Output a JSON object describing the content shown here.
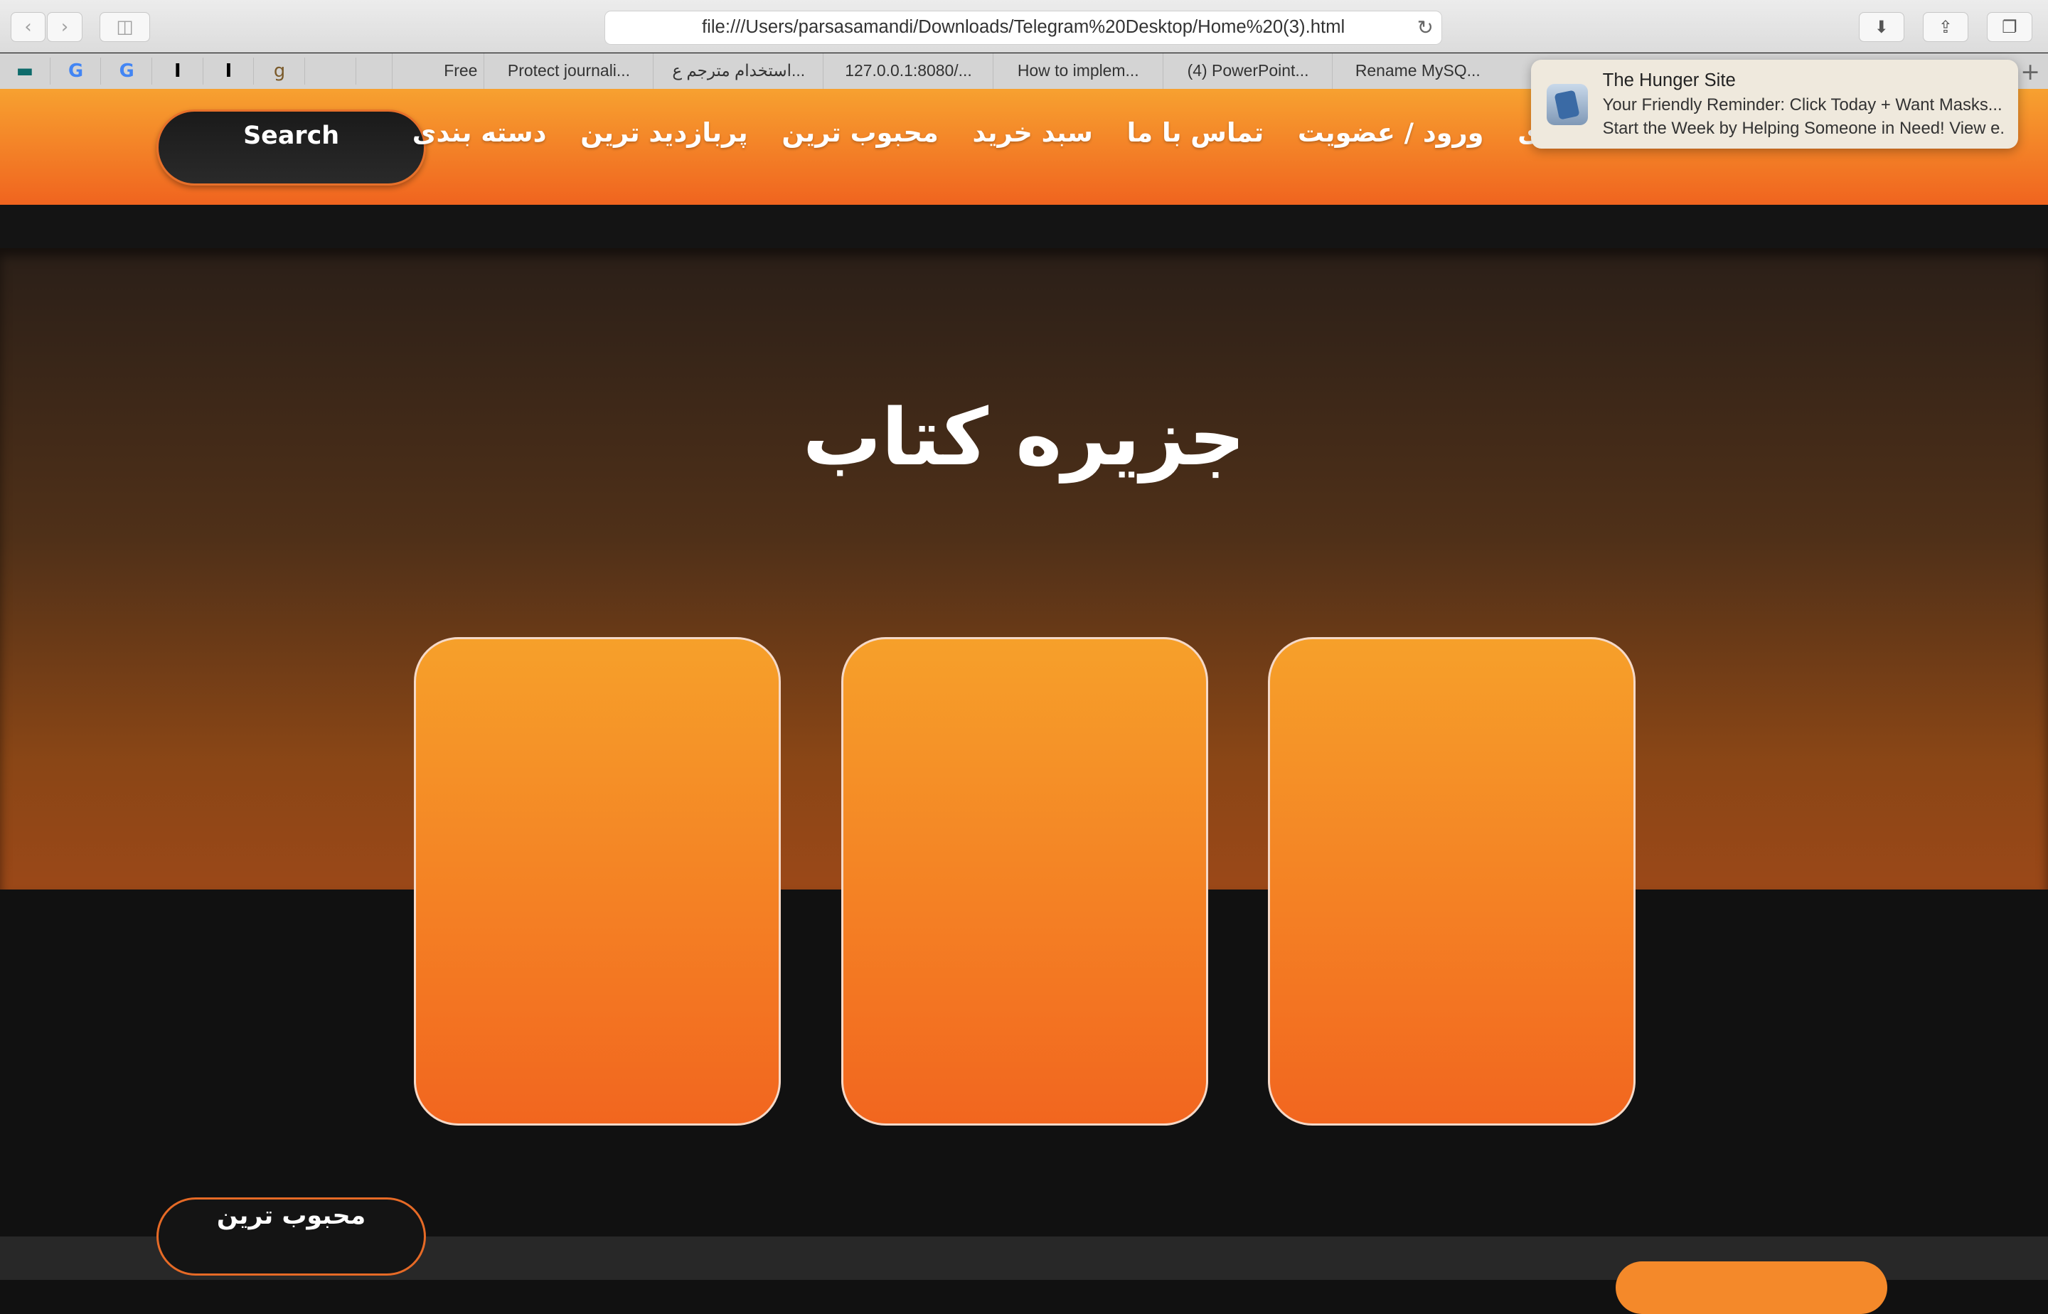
{
  "browser": {
    "url": "file:///Users/parsasamandi/Downloads/Telegram%20Desktop/Home%20(3).html",
    "pinned_tabs": [
      "bank-icon",
      "google-icon",
      "google-icon",
      "instapaper-icon",
      "instapaper-icon",
      "goodreads-icon"
    ],
    "pinned_labels": [
      "",
      "G",
      "G",
      "I",
      "I",
      "g"
    ],
    "tabs": [
      "Free",
      "Protect journali...",
      "استخدام مترجم ع...",
      "127.0.0.1:8080/...",
      "How to implem...",
      "(4) PowerPoint...",
      "Rename MySQ..."
    ]
  },
  "notification": {
    "title": "The Hunger Site",
    "line1": "Your Friendly Reminder: Click Today + Want Masks...",
    "line2": "Start the Week by Helping Someone in Need! View e..."
  },
  "header": {
    "search_label": "Search",
    "menu": [
      "دسته بندی",
      "پربازدید ترین",
      "محبوب ترین",
      "سبد خرید",
      "تماس با ما",
      "ورود / عضویت"
    ]
  },
  "hero": {
    "title": "جزیره کتاب"
  },
  "sections": {
    "popular_label": "محبوب ترین"
  },
  "colors": {
    "accent": "#f26a1f",
    "accent_light": "#f6a02a",
    "background": "#111111"
  }
}
